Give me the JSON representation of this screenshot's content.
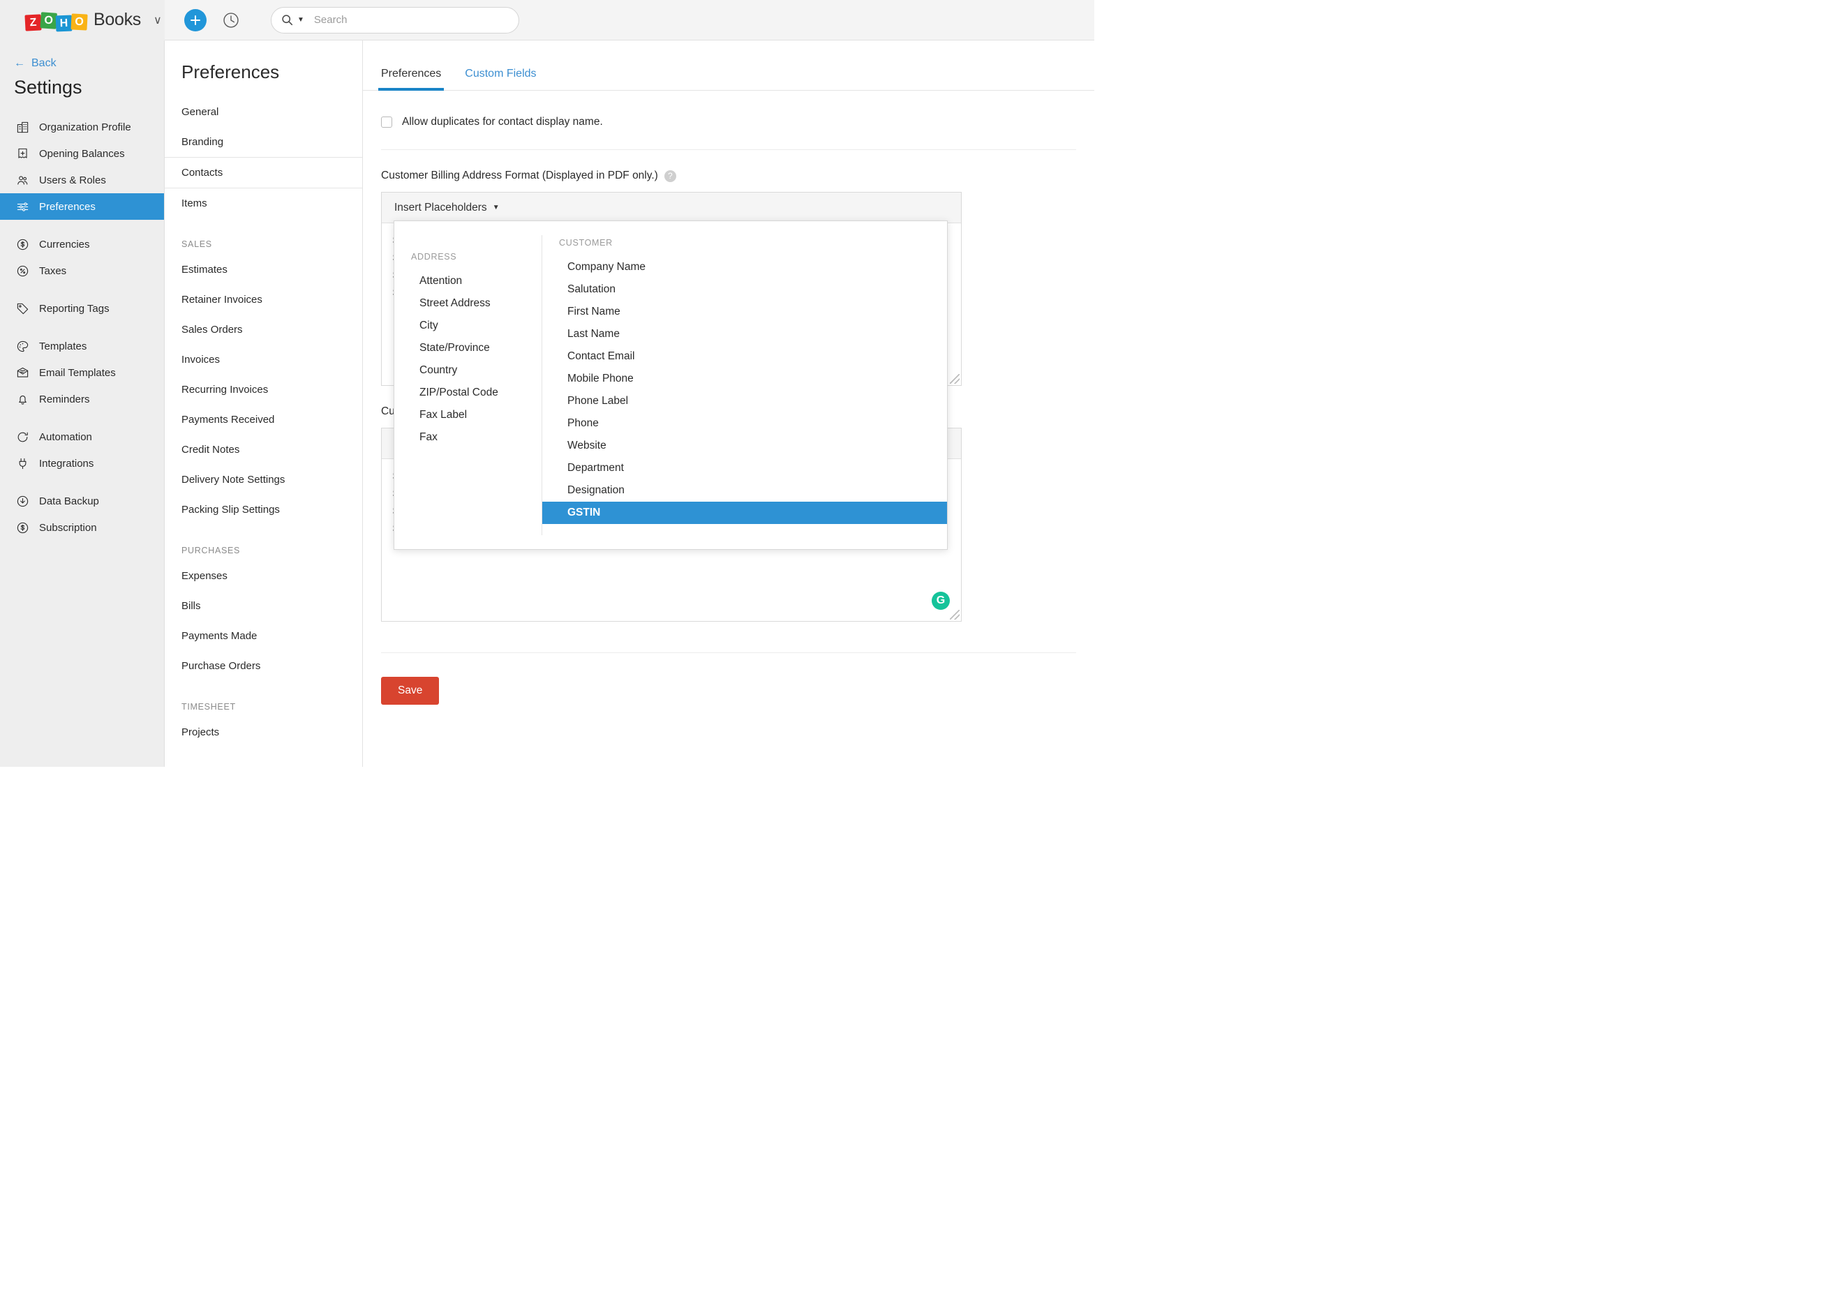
{
  "topbar": {
    "brand_blocks": [
      "Z",
      "O",
      "H",
      "O"
    ],
    "brand_name": "Books",
    "brand_caret": "∨",
    "add_icon": "plus-icon",
    "history_icon": "clock-history-icon",
    "search_placeholder": "Search",
    "search_value": "",
    "search_caret": "▼"
  },
  "sidebar": {
    "back_label": "Back",
    "back_arrow": "←",
    "title": "Settings",
    "items": [
      {
        "label": "Organization Profile",
        "icon": "building-icon"
      },
      {
        "label": "Opening Balances",
        "icon": "receipt-icon"
      },
      {
        "label": "Users & Roles",
        "icon": "users-icon"
      },
      {
        "label": "Preferences",
        "icon": "sliders-icon",
        "active": true
      },
      {
        "label": "Currencies",
        "icon": "dollar-circle-icon"
      },
      {
        "label": "Taxes",
        "icon": "percent-circle-icon"
      },
      {
        "label": "Reporting Tags",
        "icon": "tag-icon"
      },
      {
        "label": "Templates",
        "icon": "palette-icon"
      },
      {
        "label": "Email Templates",
        "icon": "envelope-icon"
      },
      {
        "label": "Reminders",
        "icon": "bell-icon"
      },
      {
        "label": "Automation",
        "icon": "refresh-icon"
      },
      {
        "label": "Integrations",
        "icon": "plug-icon"
      },
      {
        "label": "Data Backup",
        "icon": "download-icon"
      },
      {
        "label": "Subscription",
        "icon": "dollar-circle-icon"
      }
    ]
  },
  "preferences_column": {
    "title": "Preferences",
    "groups": [
      {
        "section": "",
        "items": [
          {
            "label": "General"
          },
          {
            "label": "Branding"
          },
          {
            "label": "Contacts",
            "selected": true
          },
          {
            "label": "Items"
          }
        ]
      },
      {
        "section": "SALES",
        "items": [
          {
            "label": "Estimates"
          },
          {
            "label": "Retainer Invoices"
          },
          {
            "label": "Sales Orders"
          },
          {
            "label": "Invoices"
          },
          {
            "label": "Recurring Invoices"
          },
          {
            "label": "Payments Received"
          },
          {
            "label": "Credit Notes"
          },
          {
            "label": "Delivery Note Settings"
          },
          {
            "label": "Packing Slip Settings"
          }
        ]
      },
      {
        "section": "PURCHASES",
        "items": [
          {
            "label": "Expenses"
          },
          {
            "label": "Bills"
          },
          {
            "label": "Payments Made"
          },
          {
            "label": "Purchase Orders"
          }
        ]
      },
      {
        "section": "TIMESHEET",
        "items": [
          {
            "label": "Projects"
          }
        ]
      }
    ]
  },
  "main": {
    "tabs": [
      {
        "label": "Preferences",
        "active": true
      },
      {
        "label": "Custom Fields",
        "active": false
      }
    ],
    "allow_duplicates_label": "Allow duplicates for contact display name.",
    "allow_duplicates_checked": false,
    "billing_label": "Customer Billing Address Format (Displayed in PDF only.)",
    "help_icon_glyph": "?",
    "insert_placeholders_label": "Insert Placeholders",
    "insert_placeholders_caret": "▼",
    "billing_editor_lines": [
      "$",
      "$",
      "$",
      "$"
    ],
    "shipping_label": "Cu",
    "shipping_editor_lines": [
      "$",
      "$",
      "$",
      "$"
    ],
    "grammarly_glyph": "G",
    "save_label": "Save"
  },
  "placeholder_popup": {
    "address": {
      "heading": "ADDRESS",
      "items": [
        "Attention",
        "Street Address",
        "City",
        "State/Province",
        "Country",
        "ZIP/Postal Code",
        "Fax Label",
        "Fax"
      ]
    },
    "customer": {
      "heading": "CUSTOMER",
      "items": [
        "Company Name",
        "Salutation",
        "First Name",
        "Last Name",
        "Contact Email",
        "Mobile Phone",
        "Phone Label",
        "Phone",
        "Website",
        "Department",
        "Designation",
        "GSTIN"
      ],
      "highlighted": "GSTIN"
    }
  },
  "colors": {
    "accent_blue": "#2e92d4",
    "link_blue": "#3d8fd1",
    "tab_underline": "#1a84c7",
    "save_red": "#d8442f",
    "grammarly_green": "#15c39a"
  }
}
